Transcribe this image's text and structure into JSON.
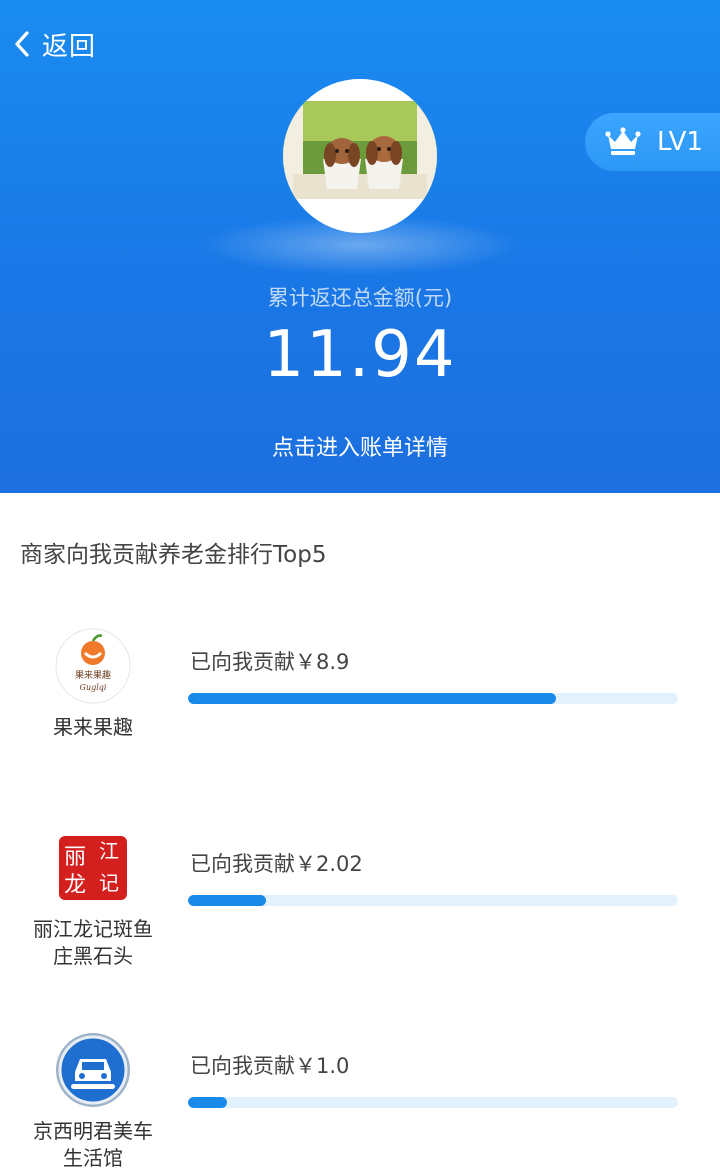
{
  "header": {
    "back_label": "返回",
    "level_label": "LV1",
    "total_label": "累计返还总金额(元)",
    "total_value": "11.94",
    "bill_link": "点击进入账单详情",
    "colors": {
      "primary": "#1a80eb",
      "badge": "#2c97f5"
    }
  },
  "ranking": {
    "title": "商家向我贡献养老金排行Top5",
    "bar_color": "#1a8aea",
    "track_color": "#e3f1fc",
    "items": [
      {
        "name": "果来果趣",
        "amount_text": "已向我贡献￥8.9",
        "amount": 8.9,
        "progress": 0.75,
        "logo_text": "果来果趣",
        "logo_subtext": "Guglqi"
      },
      {
        "name": "丽江龙记斑鱼庄黑石头",
        "amount_text": "已向我贡献￥2.02",
        "amount": 2.02,
        "progress": 0.16,
        "logo_chars": [
          "丽",
          "江",
          "龙",
          "记"
        ]
      },
      {
        "name": "京西明君美车生活馆",
        "amount_text": "已向我贡献￥1.0",
        "amount": 1.0,
        "progress": 0.08
      }
    ]
  }
}
